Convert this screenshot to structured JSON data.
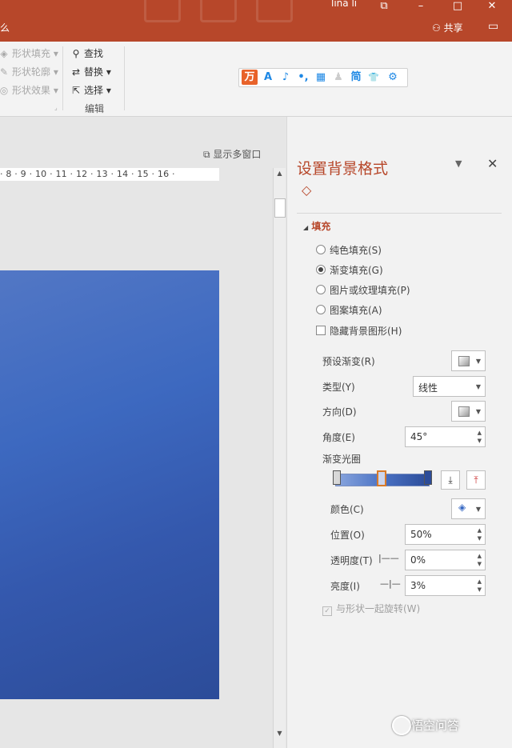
{
  "titlebar": {
    "user": "lina li",
    "share": "共享",
    "left_fragment": "么"
  },
  "ribbon": {
    "drawing": [
      {
        "label": "形状填充",
        "icon": "paint-bucket-icon"
      },
      {
        "label": "形状轮廓",
        "icon": "pen-icon"
      },
      {
        "label": "形状效果",
        "icon": "effects-icon"
      }
    ],
    "editing": [
      {
        "label": "查找",
        "icon": "search-icon"
      },
      {
        "label": "替换",
        "icon": "replace-icon"
      },
      {
        "label": "选择",
        "icon": "cursor-icon"
      }
    ],
    "editing_group": "编辑",
    "ai_toolbar": [
      "万",
      "A",
      "♪",
      "•,",
      "▦",
      "♟",
      "简",
      "👕",
      "⚙"
    ]
  },
  "slide_area": {
    "multi_window": "显示多窗口",
    "ruler": "· 8 · 9 · 10 · 11 · 12 · 13 · 14 · 15 · 16 ·"
  },
  "pane": {
    "title": "设置背景格式",
    "section": "填充",
    "fill_options": [
      {
        "label": "纯色填充(S)",
        "checked": false
      },
      {
        "label": "渐变填充(G)",
        "checked": true
      },
      {
        "label": "图片或纹理填充(P)",
        "checked": false
      },
      {
        "label": "图案填充(A)",
        "checked": false
      }
    ],
    "hide_bg": "隐藏背景图形(H)",
    "preset_label": "预设渐变(R)",
    "type_label": "类型(Y)",
    "type_value": "线性",
    "direction_label": "方向(D)",
    "angle_label": "角度(E)",
    "angle_value": "45°",
    "stops_label": "渐变光圈",
    "color_label": "颜色(C)",
    "position_label": "位置(O)",
    "position_value": "50%",
    "transparency_label": "透明度(T)",
    "transparency_value": "0%",
    "brightness_label": "亮度(I)",
    "brightness_value": "3%",
    "rotate_label": "与形状一起旋转(W)"
  },
  "watermark": "悟空问答",
  "colors": {
    "accent": "#b7472a",
    "slide_blue": "#3458ad"
  }
}
